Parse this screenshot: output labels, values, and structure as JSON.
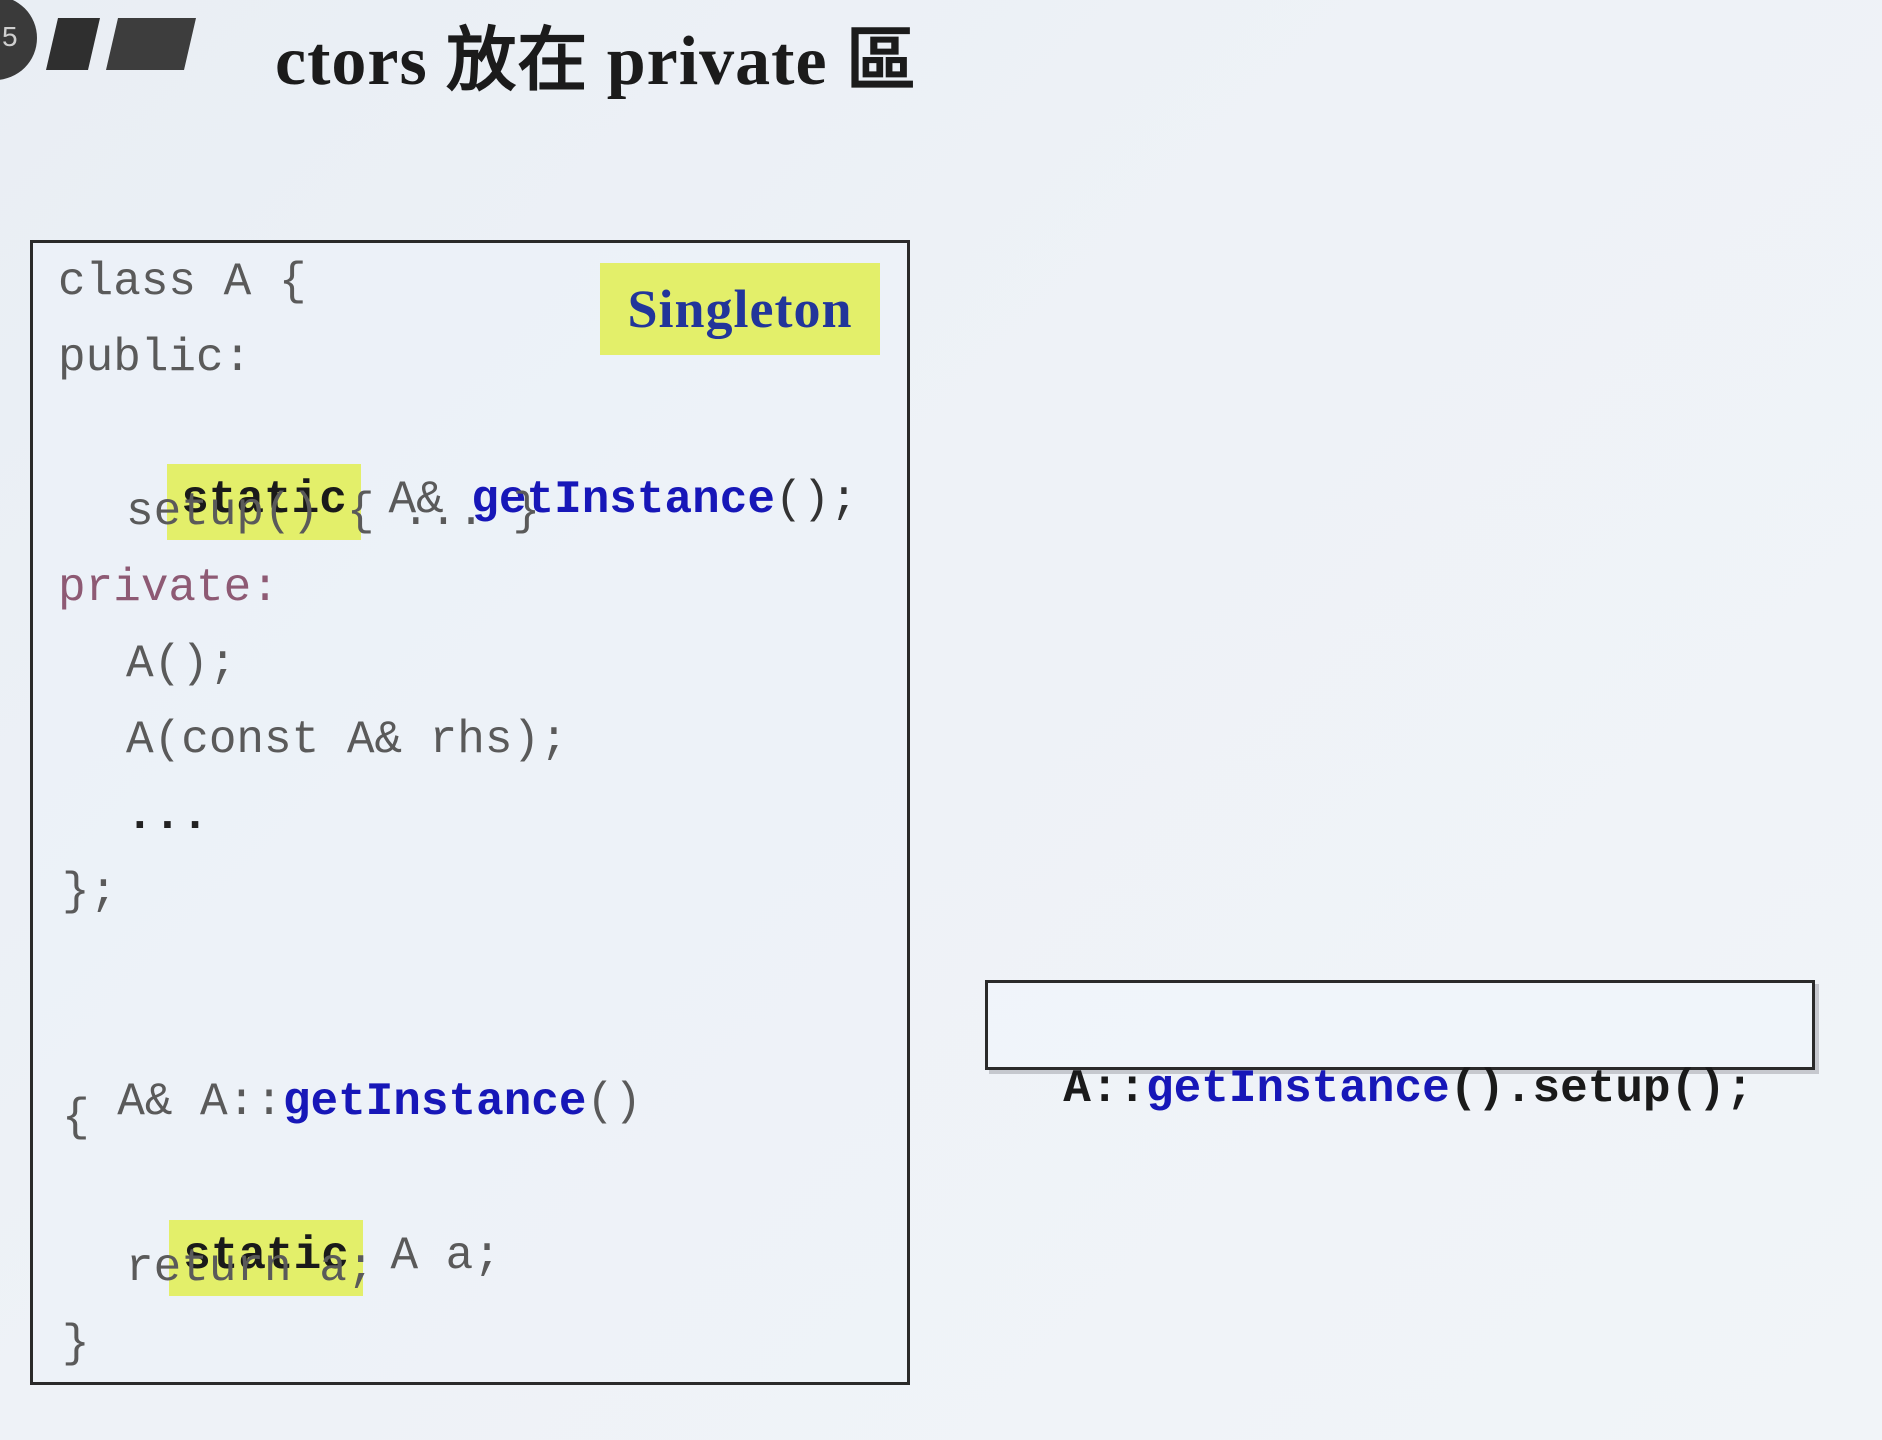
{
  "slide": {
    "title": "ctors 放在 private 區",
    "page_badge": "5"
  },
  "badge": {
    "label": "Singleton"
  },
  "code": {
    "class_open": "class A {",
    "public_label": "public:",
    "static_1": "static",
    "getinstance_ret": " A& ",
    "getinstance_name": "getInstance",
    "getinstance_parens": "();",
    "setup_line": "setup() { ... }",
    "private_label": "private:",
    "ctor_default": "A();",
    "ctor_copy": "A(const A& rhs);",
    "ellipsis": "...",
    "class_close": "};",
    "def_ret": "A& A::",
    "def_name": "getInstance",
    "def_parens": "()",
    "brace_open": "{",
    "static_2": "static",
    "static_decl": " A a;",
    "return_stmt": "return a;",
    "brace_close": "}"
  },
  "call_example": {
    "prefix": "A::",
    "func": "getInstance",
    "suffix": "().setup();"
  }
}
